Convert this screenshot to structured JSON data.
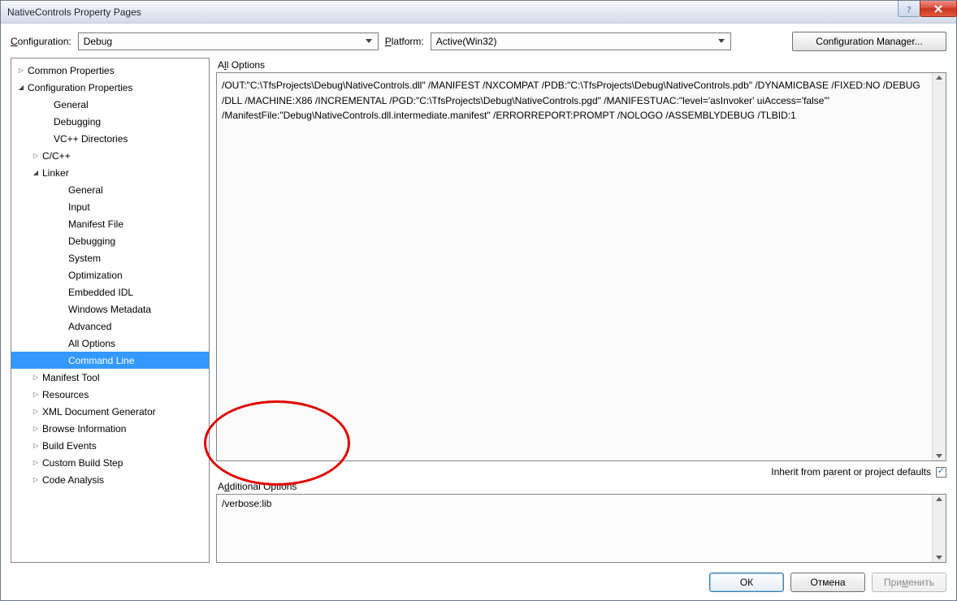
{
  "window": {
    "title": "NativeControls Property Pages"
  },
  "toolbar": {
    "configuration_label": "Configuration:",
    "configuration_value": "Debug",
    "platform_label": "Platform:",
    "platform_value": "Active(Win32)",
    "cfg_manager_label": "Configuration Manager..."
  },
  "tree": {
    "items": [
      {
        "level": 0,
        "twist": "col",
        "label": "Common Properties",
        "sel": false
      },
      {
        "level": 0,
        "twist": "exp",
        "label": "Configuration Properties",
        "sel": false
      },
      {
        "level": 1,
        "twist": "",
        "label": "General",
        "sel": false
      },
      {
        "level": 1,
        "twist": "",
        "label": "Debugging",
        "sel": false
      },
      {
        "level": 1,
        "twist": "",
        "label": "VC++ Directories",
        "sel": false
      },
      {
        "level": 1,
        "twist": "col",
        "label": "C/C++",
        "sel": false
      },
      {
        "level": 1,
        "twist": "exp",
        "label": "Linker",
        "sel": false
      },
      {
        "level": 2,
        "twist": "",
        "label": "General",
        "sel": false
      },
      {
        "level": 2,
        "twist": "",
        "label": "Input",
        "sel": false
      },
      {
        "level": 2,
        "twist": "",
        "label": "Manifest File",
        "sel": false
      },
      {
        "level": 2,
        "twist": "",
        "label": "Debugging",
        "sel": false
      },
      {
        "level": 2,
        "twist": "",
        "label": "System",
        "sel": false
      },
      {
        "level": 2,
        "twist": "",
        "label": "Optimization",
        "sel": false
      },
      {
        "level": 2,
        "twist": "",
        "label": "Embedded IDL",
        "sel": false
      },
      {
        "level": 2,
        "twist": "",
        "label": "Windows Metadata",
        "sel": false
      },
      {
        "level": 2,
        "twist": "",
        "label": "Advanced",
        "sel": false
      },
      {
        "level": 2,
        "twist": "",
        "label": "All Options",
        "sel": false
      },
      {
        "level": 2,
        "twist": "",
        "label": "Command Line",
        "sel": true
      },
      {
        "level": 1,
        "twist": "col",
        "label": "Manifest Tool",
        "sel": false
      },
      {
        "level": 1,
        "twist": "col",
        "label": "Resources",
        "sel": false
      },
      {
        "level": 1,
        "twist": "col",
        "label": "XML Document Generator",
        "sel": false
      },
      {
        "level": 1,
        "twist": "col",
        "label": "Browse Information",
        "sel": false
      },
      {
        "level": 1,
        "twist": "col",
        "label": "Build Events",
        "sel": false
      },
      {
        "level": 1,
        "twist": "col",
        "label": "Custom Build Step",
        "sel": false
      },
      {
        "level": 1,
        "twist": "col",
        "label": "Code Analysis",
        "sel": false
      }
    ]
  },
  "right": {
    "all_options_label": "All Options",
    "all_options_text": "/OUT:\"C:\\TfsProjects\\Debug\\NativeControls.dll\" /MANIFEST /NXCOMPAT /PDB:\"C:\\TfsProjects\\Debug\\NativeControls.pdb\" /DYNAMICBASE /FIXED:NO /DEBUG /DLL /MACHINE:X86 /INCREMENTAL /PGD:\"C:\\TfsProjects\\Debug\\NativeControls.pgd\" /MANIFESTUAC:\"level='asInvoker' uiAccess='false'\" /ManifestFile:\"Debug\\NativeControls.dll.intermediate.manifest\" /ERRORREPORT:PROMPT /NOLOGO /ASSEMBLYDEBUG /TLBID:1",
    "inherit_label": "Inherit from parent or project defaults",
    "inherit_checked": true,
    "additional_options_label": "Additional Options",
    "additional_options_text": "/verbose:lib"
  },
  "buttons": {
    "ok": "ОК",
    "cancel": "Отмена",
    "apply": "Применить"
  }
}
